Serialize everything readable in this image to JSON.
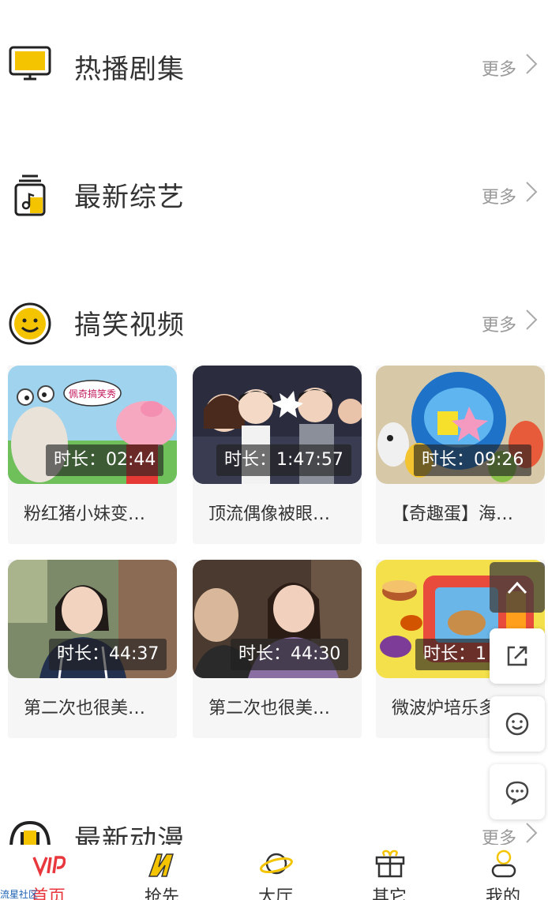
{
  "sections": [
    {
      "title": "热播剧集",
      "more": "更多",
      "icon": "tv-icon"
    },
    {
      "title": "最新综艺",
      "more": "更多",
      "icon": "music-note-icon"
    },
    {
      "title": "搞笑视频",
      "more": "更多",
      "icon": "smiley-icon"
    },
    {
      "title": "最新动漫",
      "more": "更多",
      "icon": "anime-icon"
    }
  ],
  "videos": [
    {
      "duration": "时长：02:44",
      "title": "粉红猪小妹变…"
    },
    {
      "duration": "时长：1:47:57",
      "title": "顶流偶像被眼…"
    },
    {
      "duration": "时长：09:26",
      "title": "【奇趣蛋】海…"
    },
    {
      "duration": "时长：44:37",
      "title": "第二次也很美…"
    },
    {
      "duration": "时长：44:30",
      "title": "第二次也很美…"
    },
    {
      "duration": "时长：1",
      "title": "微波炉培乐多"
    }
  ],
  "thumb_texts": {
    "bubble": "佩奇搞笑秀"
  },
  "tabs": [
    {
      "label": "首页",
      "icon": "vip-icon",
      "active": true
    },
    {
      "label": "抢先",
      "icon": "m-logo-icon",
      "active": false
    },
    {
      "label": "大厅",
      "icon": "planet-icon",
      "active": false
    },
    {
      "label": "其它",
      "icon": "gift-icon",
      "active": false
    },
    {
      "label": "我的",
      "icon": "profile-icon",
      "active": false
    }
  ],
  "colors": {
    "accent": "#f5c400",
    "active_tab": "#e8383d",
    "text": "#333333",
    "muted": "#999999"
  },
  "watermark": "流星社区"
}
